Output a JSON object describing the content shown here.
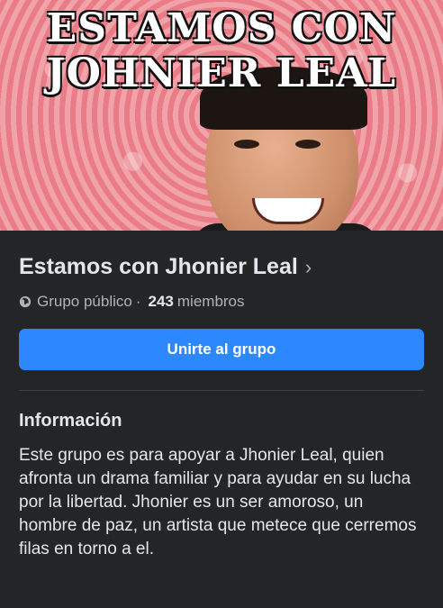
{
  "cover": {
    "line1": "ESTAMOS CON",
    "line2": "JOHNIER LEAL"
  },
  "group": {
    "title": "Estamos con Jhonier Leal",
    "title_chevron": "›",
    "privacy": "Grupo público",
    "separator": "·",
    "member_count": "243",
    "members_label": "miembros"
  },
  "join_button": {
    "label": "Unirte al grupo"
  },
  "info": {
    "heading": "Información",
    "text": "Este grupo es para apoyar a Jhonier Leal, quien afronta un drama familiar y para ayudar en su lucha por la libertad. Jhonier es un ser amoroso, un hombre de paz, un artista que metece que cerremos filas en torno a el."
  },
  "colors": {
    "background": "#242526",
    "accent": "#2d88ff",
    "text_primary": "#e4e6eb",
    "text_secondary": "#b0b3b8"
  },
  "icons": {
    "privacy": "globe-icon",
    "chevron": "chevron-right-icon"
  }
}
